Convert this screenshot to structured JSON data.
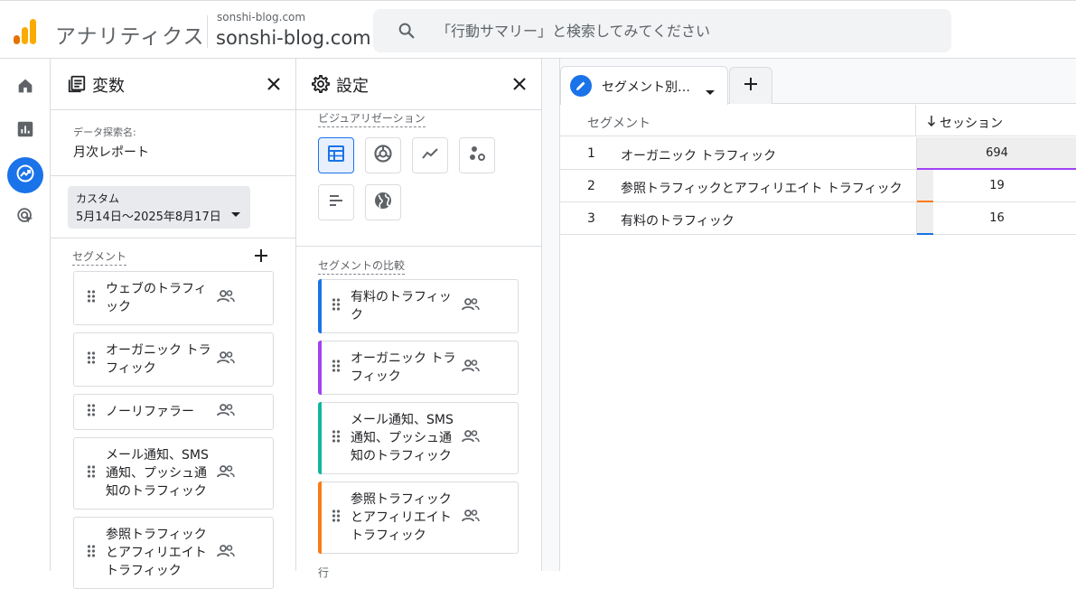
{
  "header": {
    "app_title": "アナリティクス",
    "property_small": "sonshi-blog.com",
    "property_big": "sonshi-blog.com",
    "search_placeholder": "「行動サマリー」と検索してみてください"
  },
  "rail": {
    "items": [
      {
        "icon": "home-icon"
      },
      {
        "icon": "reports-icon"
      },
      {
        "icon": "explore-icon",
        "active": true
      },
      {
        "icon": "advertising-icon"
      }
    ]
  },
  "variables": {
    "title": "変数",
    "exploration_name_label": "データ探索名:",
    "exploration_name": "月次レポート",
    "date_label": "カスタム",
    "date_range": "5月14日〜2025年8月17日",
    "segments_label": "セグメント",
    "segments": [
      "ウェブのトラフィック",
      "オーガニック トラフィック",
      "ノーリファラー",
      "メール通知、SMS 通知、プッシュ通知のトラフィック",
      "参照トラフィック とアフィリエイト トラフィック"
    ]
  },
  "settings": {
    "title": "設定",
    "visualization_label": "ビジュアリゼーション",
    "segment_compare_label": "セグメントの比較",
    "compare_segments": [
      {
        "label": "有料のトラフィック",
        "color": "#1a73e8"
      },
      {
        "label": "オーガニック トラフィック",
        "color": "#a142f4"
      },
      {
        "label": "メール通知、SMS 通知、プッシュ通知のトラフィック",
        "color": "#12b5a0"
      },
      {
        "label": "参照トラフィック とアフィリエイト トラフィック",
        "color": "#fa7b17"
      }
    ],
    "bottom_partial_label": "行"
  },
  "canvas": {
    "tab_label": "セグメント別…",
    "table": {
      "col_segment": "セグメント",
      "col_sessions": "セッション",
      "rows": [
        {
          "num": "1",
          "name": "オーガニック トラフィック",
          "value": "694",
          "fraction": 1.0,
          "color": "#a142f4"
        },
        {
          "num": "2",
          "name": "参照トラフィックとアフィリエイト トラフィック",
          "value": "19",
          "fraction": 0.027,
          "color": "#fa7b17"
        },
        {
          "num": "3",
          "name": "有料のトラフィック",
          "value": "16",
          "fraction": 0.023,
          "color": "#1a73e8"
        }
      ]
    }
  },
  "colors": {
    "logo_light": "#f9ab00",
    "logo_dark": "#e37400",
    "accent": "#1a73e8"
  }
}
